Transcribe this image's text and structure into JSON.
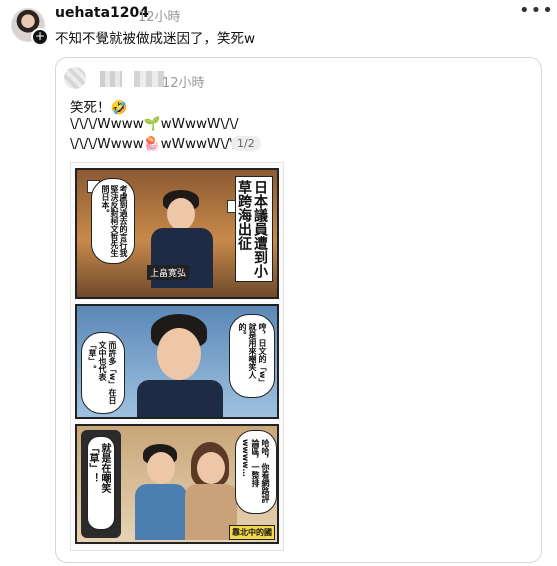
{
  "post": {
    "username": "uehata1204",
    "time": "12小時",
    "text": "不知不覺就被做成迷因了，笑死w",
    "more_icon": "more-icon"
  },
  "quote": {
    "time": "12小時",
    "lines": [
      "笑死！🤣",
      "\\/\\/\\/Wwww🌱wWwwW\\/\\/",
      "\\/\\/\\/Wwww🪼wWwwW\\/\\/"
    ],
    "page_indicator": "1/2"
  },
  "comic": {
    "panel1_title": "日本議員遭到小草跨海出征",
    "panel1_bubble": "考慮到過去的言行我堅決反對柯文哲先生問日本。",
    "panel1_nametag": "上畠寛弘",
    "panel2_bubble_right": "哼，日文的「w」就是用來嘲笑人的。",
    "panel2_bubble_left": "而許多「w」在日文中也代表「草」。",
    "panel3_phone_text": "就是在嘲笑「草」！",
    "panel3_bubble": "哈哈，你看網路評論區，一整排wwww…",
    "watermark": "靠北中的國"
  }
}
